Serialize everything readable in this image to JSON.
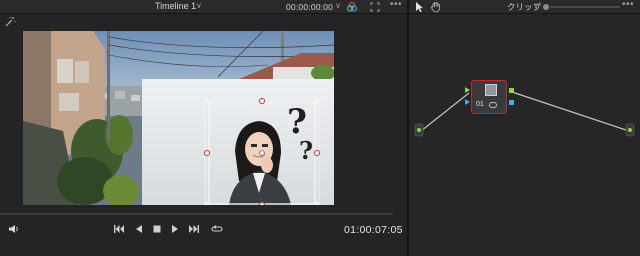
{
  "viewer": {
    "title": "Timeline 1",
    "title_chevron": "∨",
    "timecode_top": "00:00:00:00",
    "timecode_chevron": "∨",
    "more": "•••",
    "playhead_timecode": "01:00:07:05",
    "icons": [
      "color-wheel-icon",
      "fit-icon",
      "magic-wand-icon"
    ]
  },
  "transport": {
    "buttons": [
      "volume-icon",
      "skip-back-icon",
      "step-back-icon",
      "stop-icon",
      "play-icon",
      "skip-forward-icon",
      "loop-icon"
    ]
  },
  "nodes": {
    "clip_label": "クリップ",
    "clip_chevron": "∨",
    "more": "•••",
    "node_number": "01",
    "tools": [
      "pointer-icon",
      "hand-icon"
    ]
  },
  "colors": {
    "node_border": "#c02a2a",
    "connector_green": "#8fd34a",
    "connector_blue": "#3ab4e8",
    "panel_bg": "#262629"
  }
}
